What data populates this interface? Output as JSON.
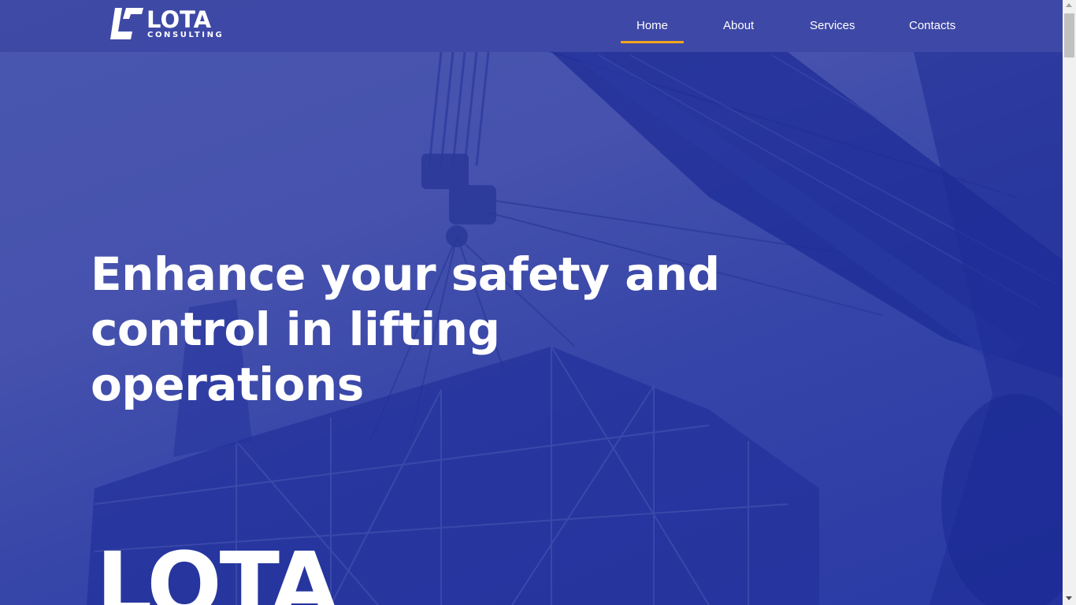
{
  "header": {
    "logo": {
      "wordmark": "LOTA",
      "subtitle": "CONSULTING"
    },
    "nav": [
      {
        "label": "Home",
        "active": true
      },
      {
        "label": "About",
        "active": false
      },
      {
        "label": "Services",
        "active": false
      },
      {
        "label": "Contacts",
        "active": false
      }
    ]
  },
  "hero": {
    "headline": "Enhance your safety and control in lifting operations",
    "brand_text": "LOTA"
  },
  "colors": {
    "hero_overlay": "#3f4aa8",
    "accent_underline": "#f3a51b",
    "text": "#ffffff"
  }
}
